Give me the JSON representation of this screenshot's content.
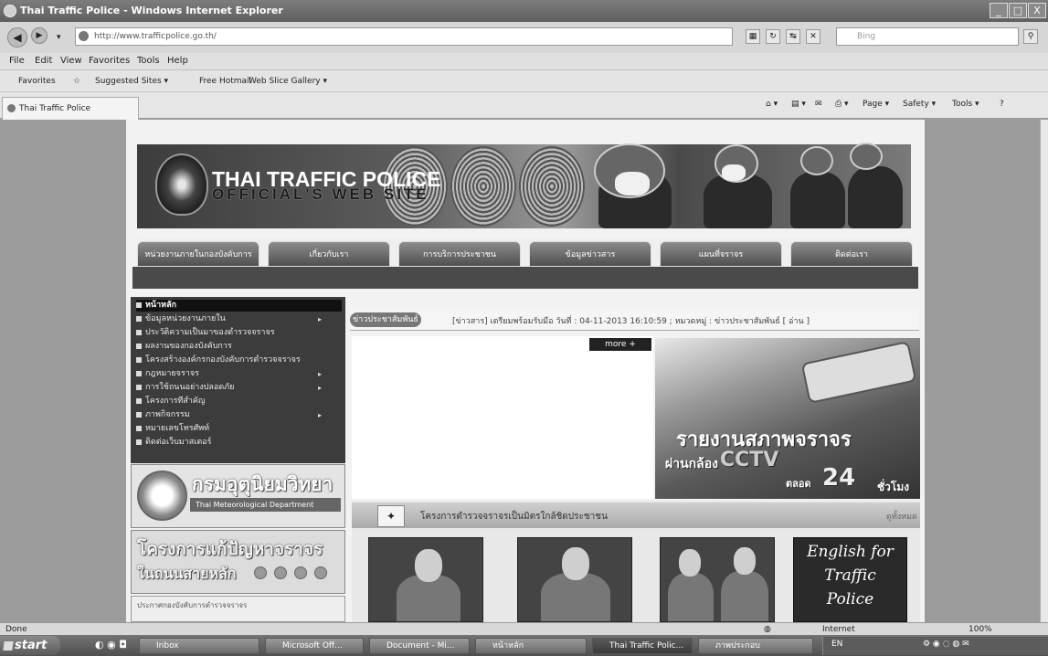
{
  "window": {
    "title": "Thai Traffic Police - Windows Internet Explorer",
    "minimize": "_",
    "maximize": "□",
    "close": "X"
  },
  "address_bar": {
    "url": "http://www.trafficpolice.go.th/",
    "search_placeholder": "Bing",
    "back_glyph": "◀",
    "forward_glyph": "▶"
  },
  "menu": [
    "File",
    "Edit",
    "View",
    "Favorites",
    "Tools",
    "Help"
  ],
  "favorites_bar": {
    "favorites": "Favorites",
    "suggested": "Suggested Sites ▾",
    "free_hotmail": "Free Hotmail",
    "web_slice": "Web Slice Gallery ▾"
  },
  "tab": {
    "label": "Thai Traffic Police"
  },
  "command_bar": [
    "Page ▾",
    "Safety ▾",
    "Tools ▾",
    "?"
  ],
  "site": {
    "title": "THAI TRAFFIC POLICE",
    "subtitle": "OFFICIAL'S WEB SITE"
  },
  "nav_tabs": [
    "หน่วยงานภายในกองบังคับการ",
    "เกี่ยวกับเรา",
    "การบริการประชาชน",
    "ข้อมูลข่าวสาร",
    "แผนที่จราจร",
    "ติดต่อเรา"
  ],
  "side_menu": [
    {
      "label": "หน้าหลัก",
      "arrow": ""
    },
    {
      "label": "ข้อมูลหน่วยงานภายใน",
      "arrow": "▸"
    },
    {
      "label": "ประวัติความเป็นมาของตำรวจจราจร",
      "arrow": ""
    },
    {
      "label": "ผลงานของกองบังคับการ",
      "arrow": ""
    },
    {
      "label": "โครงสร้างองค์กรกองบังคับการตำรวจจราจร",
      "arrow": ""
    },
    {
      "label": "กฎหมายจราจร",
      "arrow": "▸"
    },
    {
      "label": "การใช้ถนนอย่างปลอดภัย",
      "arrow": "▸"
    },
    {
      "label": "โครงการที่สำคัญ",
      "arrow": ""
    },
    {
      "label": "ภาพกิจกรรม",
      "arrow": "▸"
    },
    {
      "label": "หมายเลขโทรศัพท์",
      "arrow": ""
    },
    {
      "label": "ติดต่อเว็บมาสเตอร์",
      "arrow": ""
    }
  ],
  "tmd": {
    "title": "กรมอุตุนิยมวิทยา",
    "subtitle": "Thai Meteorological Department"
  },
  "traffic_project": {
    "title": "โครงการแก้ปัญหาจราจร",
    "subtitle": "ในถนนสายหลัก"
  },
  "left_bottom_text": "ประกาศกองบังคับการตำรวจจราจร",
  "ticker": {
    "label": "ข่าวประชาสัมพันธ์",
    "text": "[ข่าวสาร] เตรียมพร้อมรับมือ วันที่ : 04-11-2013 16:10:59 ; หมวดหมู่ : ข่าวประชาสัมพันธ์ [ อ่าน ]"
  },
  "more_button": "more +",
  "cctv": {
    "line1": "รายงานสภาพจราจร",
    "line2": "ผ่านกล้อง",
    "line3": "CCTV",
    "line4": "ตลอด",
    "line5": "24",
    "line6": "ชั่วโมง"
  },
  "videos": {
    "title": "โครงการตำรวจจราจรเป็นมิตรใกล้ชิดประชาชน",
    "see_all": "ดูทั้งหมด",
    "english_lines": [
      "English for",
      "Traffic",
      "Police"
    ]
  },
  "status": {
    "left": "Done",
    "zone": "Internet",
    "zoom": "100%"
  },
  "taskbar": {
    "start": "start",
    "tasks": [
      "Inbox",
      "Microsoft Off...",
      "Document - Mi...",
      "หน้าหลัก",
      "Thai Traffic Polic...",
      "ภาพประกอบ"
    ],
    "clock": "EN"
  }
}
